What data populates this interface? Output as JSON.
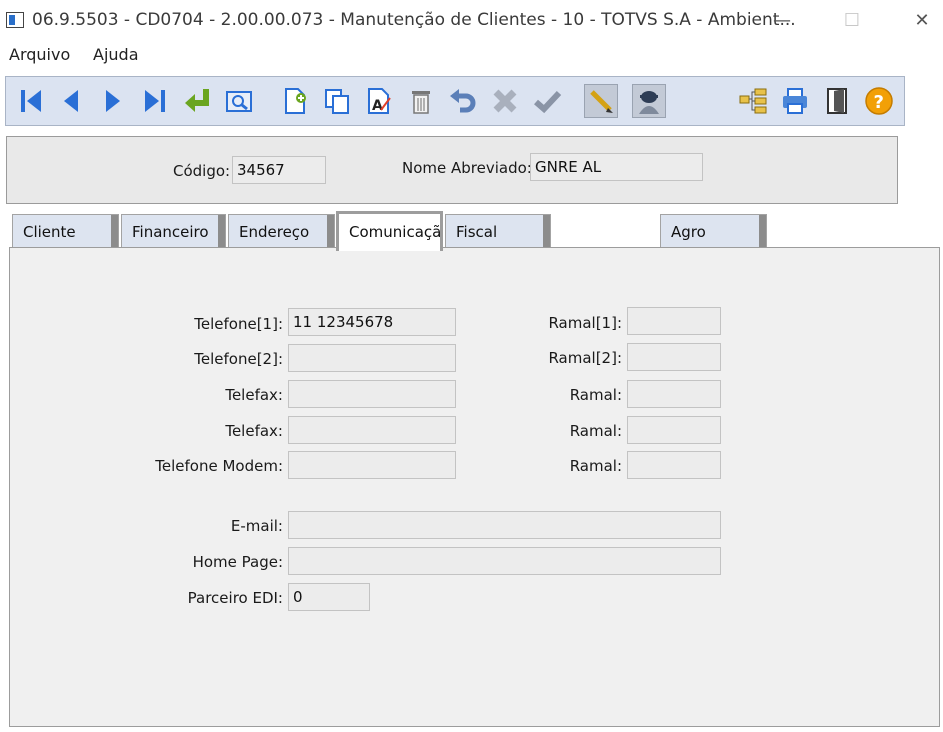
{
  "window": {
    "title": "06.9.5503 - CD0704 - 2.00.00.073 - Manutenção de Clientes - 10 - TOTVS S.A - Ambient...",
    "minimize_glyph": "—",
    "maximize_glyph": "☐",
    "close_glyph": "✕"
  },
  "menu": {
    "items": [
      "Arquivo",
      "Ajuda"
    ]
  },
  "toolbar": {
    "buttons": [
      "first-icon",
      "previous-icon",
      "next-icon",
      "last-icon",
      "goto-icon",
      "search-icon",
      "new-icon",
      "copy-icon",
      "edit-icon",
      "delete-icon",
      "undo-icon",
      "cancel-icon",
      "confirm-icon",
      "pencil-icon",
      "user-icon",
      "tree-icon",
      "print-icon",
      "exit-icon",
      "help-icon"
    ],
    "accent": "#2a6fd6"
  },
  "header": {
    "codigo_label": "Código:",
    "codigo_value": "34567",
    "nome_label": "Nome Abreviado:",
    "nome_value": "GNRE AL"
  },
  "tabs": [
    "Cliente",
    "Financeiro",
    "Endereço",
    "Comunicaçã",
    "Fiscal",
    "Agro"
  ],
  "active_tab": "Comunicaçã",
  "form": {
    "telefone1_label": "Telefone[1]:",
    "telefone1_value": "11 12345678",
    "telefone2_label": "Telefone[2]:",
    "telefone2_value": "",
    "telefax1_label": "Telefax:",
    "telefax1_value": "",
    "telefax2_label": "Telefax:",
    "telefax2_value": "",
    "modem_label": "Telefone Modem:",
    "modem_value": "",
    "ramal1_label": "Ramal[1]:",
    "ramal1_value": "",
    "ramal2_label": "Ramal[2]:",
    "ramal2_value": "",
    "ramal3_label": "Ramal:",
    "ramal3_value": "",
    "ramal4_label": "Ramal:",
    "ramal4_value": "",
    "ramal5_label": "Ramal:",
    "ramal5_value": "",
    "email_label": "E-mail:",
    "email_value": "",
    "homepage_label": "Home Page:",
    "homepage_value": "",
    "edi_label": "Parceiro EDI:",
    "edi_value": "0"
  }
}
